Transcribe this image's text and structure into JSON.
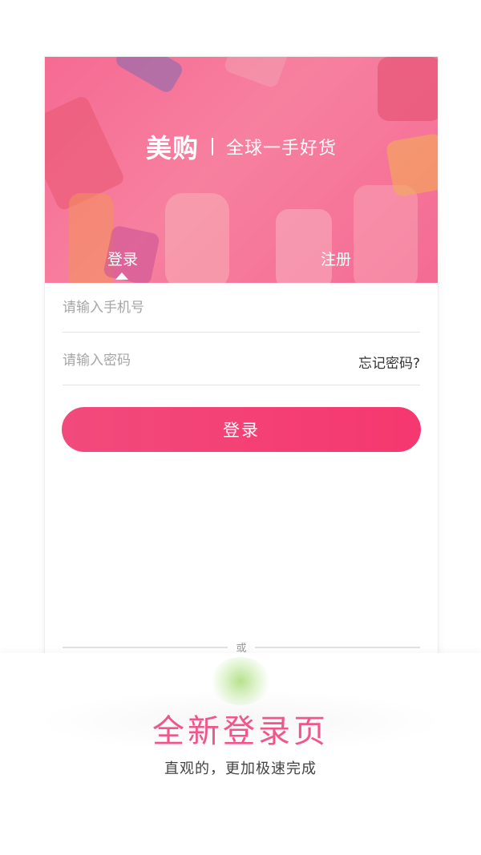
{
  "brand": {
    "logo": "美购",
    "slogan": "全球一手好货"
  },
  "tabs": [
    {
      "label": "登录",
      "active": true
    },
    {
      "label": "注册",
      "active": false
    }
  ],
  "form": {
    "phone_placeholder": "请输入手机号",
    "password_placeholder": "请输入密码",
    "forgot_label": "忘记密码?",
    "login_button": "登录"
  },
  "divider": {
    "or_label": "或"
  },
  "feature": {
    "title": "全新登录页",
    "subtitle": "直观的，更加极速完成"
  },
  "colors": {
    "brand_pink": "#f24a7c",
    "title_pink": "#f0568a"
  }
}
